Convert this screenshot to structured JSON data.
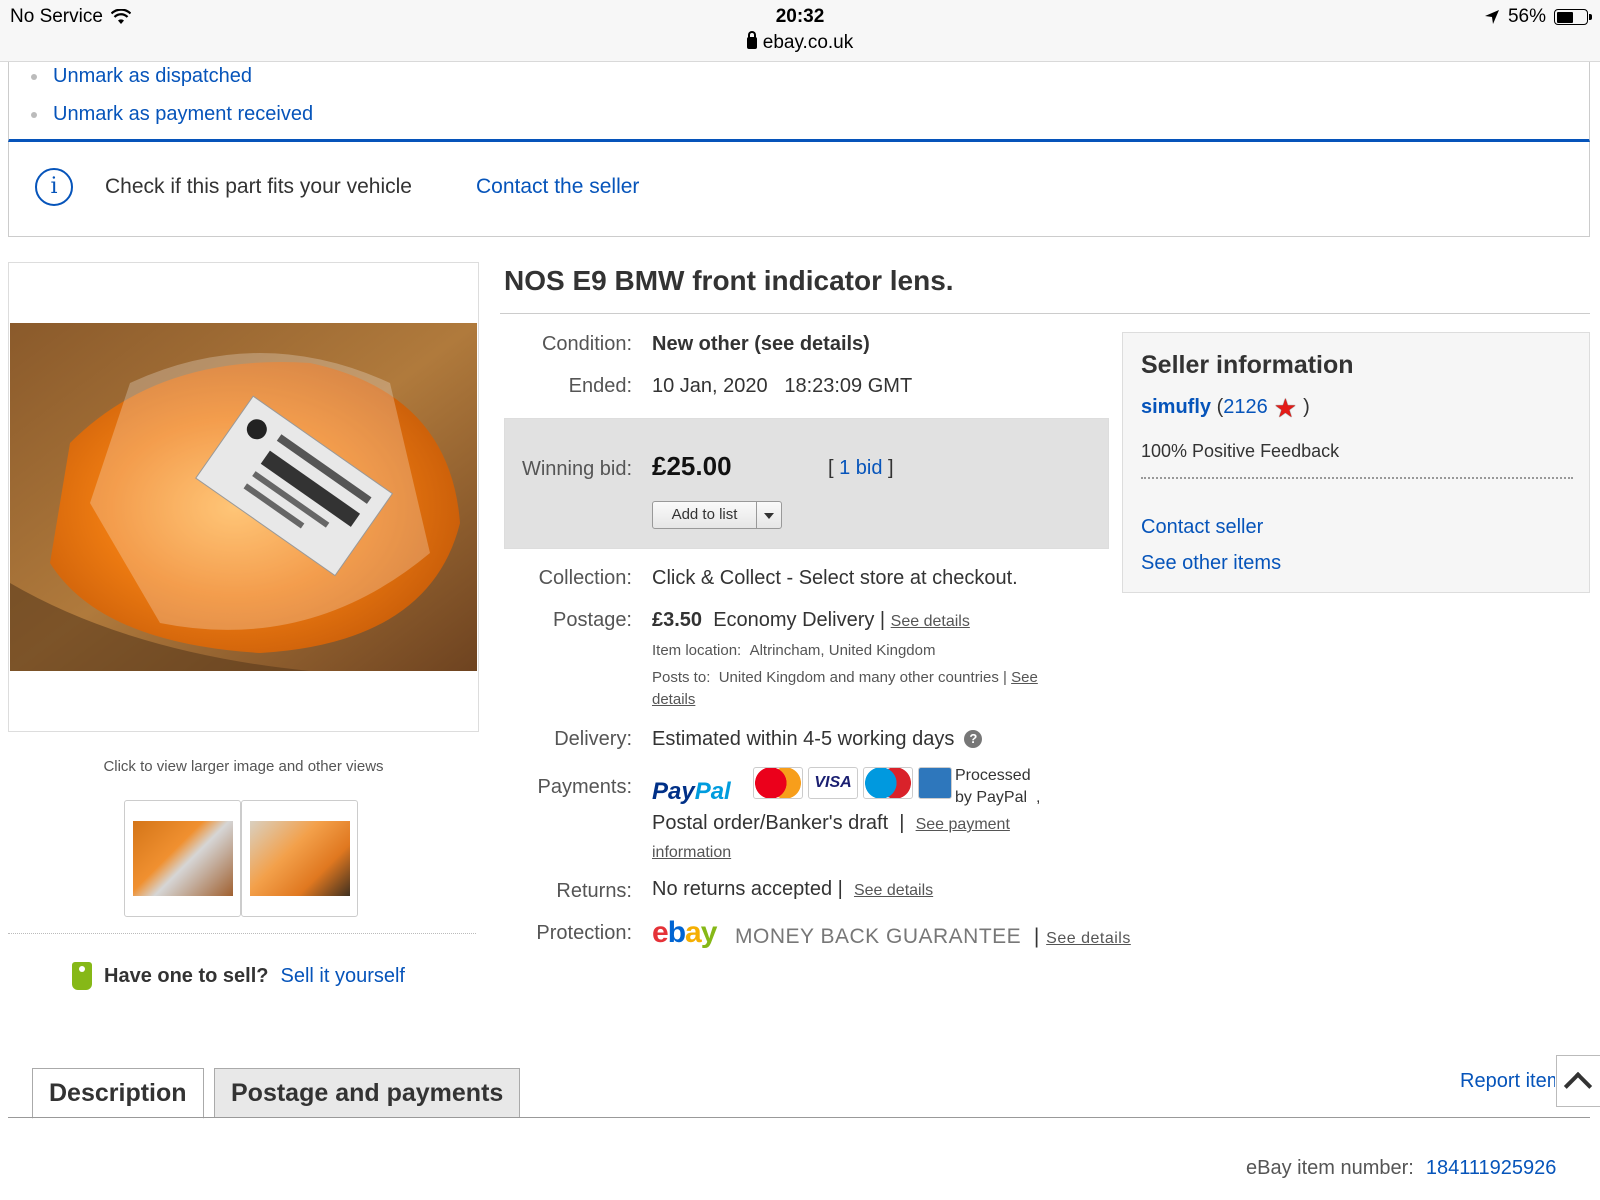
{
  "status_bar": {
    "carrier": "No Service",
    "time": "20:32",
    "url": "ebay.co.uk",
    "battery": "56%"
  },
  "actions": [
    {
      "label": "Unmark as dispatched"
    },
    {
      "label": "Unmark as payment received"
    }
  ],
  "fitment": {
    "text": "Check if this part fits your vehicle",
    "link": "Contact the seller"
  },
  "gallery": {
    "caption": "Click to view larger image and other views"
  },
  "sell": {
    "question": "Have one to sell?",
    "link": "Sell it yourself"
  },
  "item": {
    "title": "NOS E9 BMW front indicator lens.",
    "condition_label": "Condition:",
    "condition_value": "New other (see details)",
    "ended_label": "Ended:",
    "ended_date": "10 Jan, 2020",
    "ended_time": "18:23:09 GMT",
    "winning_bid_label": "Winning bid:",
    "winning_bid": "£25.00",
    "bid_open": "[ ",
    "bid_count": "1 bid",
    "bid_close": " ]",
    "add_to_list": "Add to list",
    "collection_label": "Collection:",
    "collection_value": "Click & Collect - Select store at checkout.",
    "postage_label": "Postage:",
    "postage_price": "£3.50",
    "postage_service": "Economy Delivery |",
    "postage_see_details": "See details",
    "item_location_label": "Item location:",
    "item_location": "Altrincham, United Kingdom",
    "posts_to_label": "Posts to:",
    "posts_to": "United Kingdom and many other countries |",
    "posts_to_see": "See",
    "posts_to_details": "details",
    "delivery_label": "Delivery:",
    "delivery_value": "Estimated within 4-5 working days",
    "payments_label": "Payments:",
    "paypal_1": "Pay",
    "paypal_2": "Pal",
    "processed_1": "Processed",
    "processed_2": "by PayPal",
    "processed_comma": ",",
    "postal_order": "Postal order/Banker's draft",
    "payment_sep": "|",
    "see_payment": "See payment",
    "information": "information",
    "returns_label": "Returns:",
    "returns_value": "No returns accepted |",
    "returns_see": "See details",
    "protection_label": "Protection:",
    "mbg": "MONEY BACK GUARANTEE",
    "protection_sep": "|",
    "protection_see": "See details"
  },
  "seller": {
    "heading": "Seller information",
    "name": "simufly",
    "open_paren": " (",
    "score": "2126",
    "close_paren": ")",
    "feedback": "100% Positive Feedback",
    "contact": "Contact seller",
    "other_items": "See other items"
  },
  "tabs": [
    {
      "label": "Description",
      "active": true
    },
    {
      "label": "Postage and payments",
      "active": false
    }
  ],
  "report": "Report item",
  "item_number_label": "eBay item number:",
  "item_number": "184111925926",
  "icons": [
    "wifi-icon",
    "lock-icon",
    "location-arrow-icon",
    "battery-icon",
    "info-icon",
    "tag-icon",
    "star-icon",
    "help-icon",
    "chevron-up-icon"
  ],
  "colors": {
    "link": "#0654ba",
    "accent_border": "#0654ba",
    "bid_box": "#e1e1e1"
  }
}
